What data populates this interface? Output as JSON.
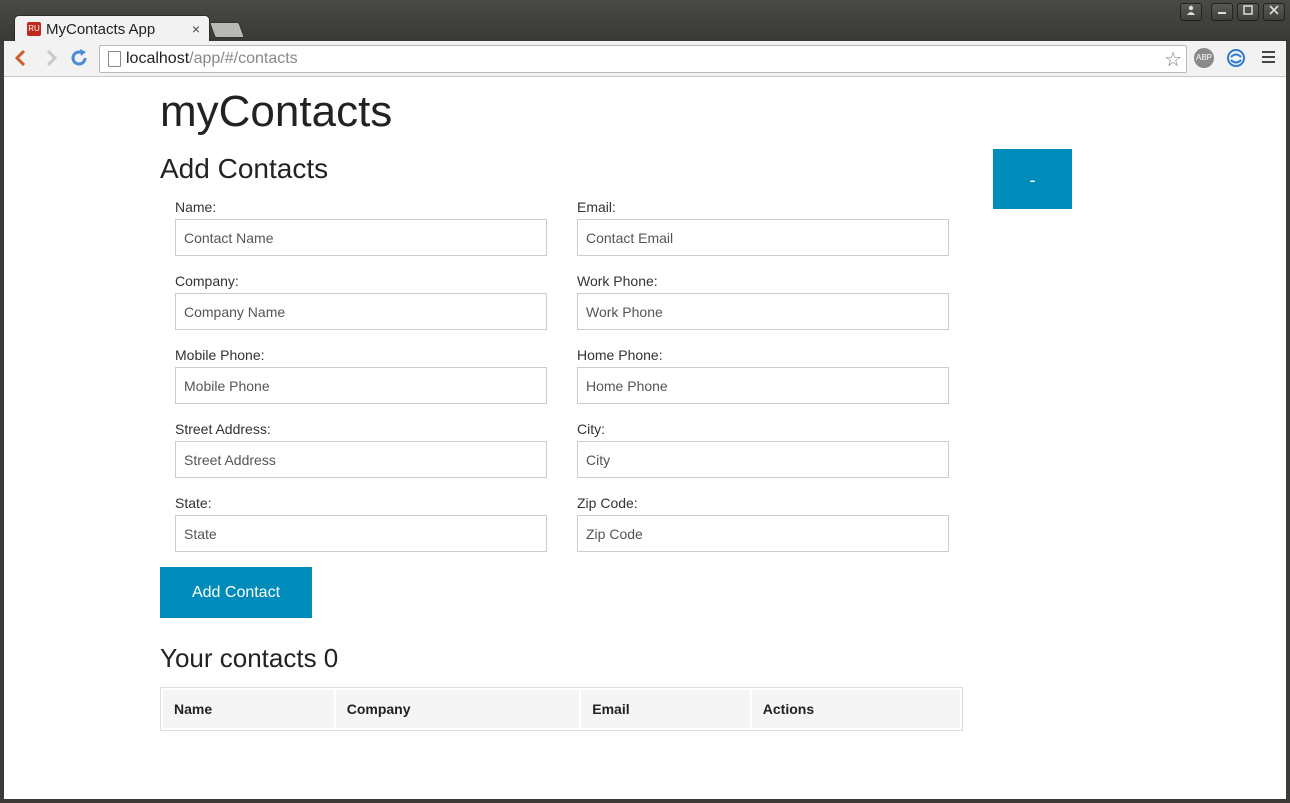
{
  "browser": {
    "tab_title": "MyContacts App",
    "favicon_text": "RU",
    "tab_close": "×",
    "url_host": "localhost",
    "url_path": "/app/#/contacts",
    "ext_abp": "ABP"
  },
  "app": {
    "title": "myContacts",
    "add_section_title": "Add Contacts",
    "toggle_button": "-",
    "fields": {
      "name": {
        "label": "Name:",
        "placeholder": "Contact Name"
      },
      "email": {
        "label": "Email:",
        "placeholder": "Contact Email"
      },
      "company": {
        "label": "Company:",
        "placeholder": "Company Name"
      },
      "work_phone": {
        "label": "Work Phone:",
        "placeholder": "Work Phone"
      },
      "mobile_phone": {
        "label": "Mobile Phone:",
        "placeholder": "Mobile Phone"
      },
      "home_phone": {
        "label": "Home Phone:",
        "placeholder": "Home Phone"
      },
      "street": {
        "label": "Street Address:",
        "placeholder": "Street Address"
      },
      "city": {
        "label": "City:",
        "placeholder": "City"
      },
      "state": {
        "label": "State:",
        "placeholder": "State"
      },
      "zip": {
        "label": "Zip Code:",
        "placeholder": "Zip Code"
      }
    },
    "add_button": "Add Contact",
    "contacts_title": "Your contacts 0",
    "table_headers": [
      "Name",
      "Company",
      "Email",
      "Actions"
    ]
  },
  "colors": {
    "accent": "#008cba",
    "favicon": "#c0271d"
  }
}
